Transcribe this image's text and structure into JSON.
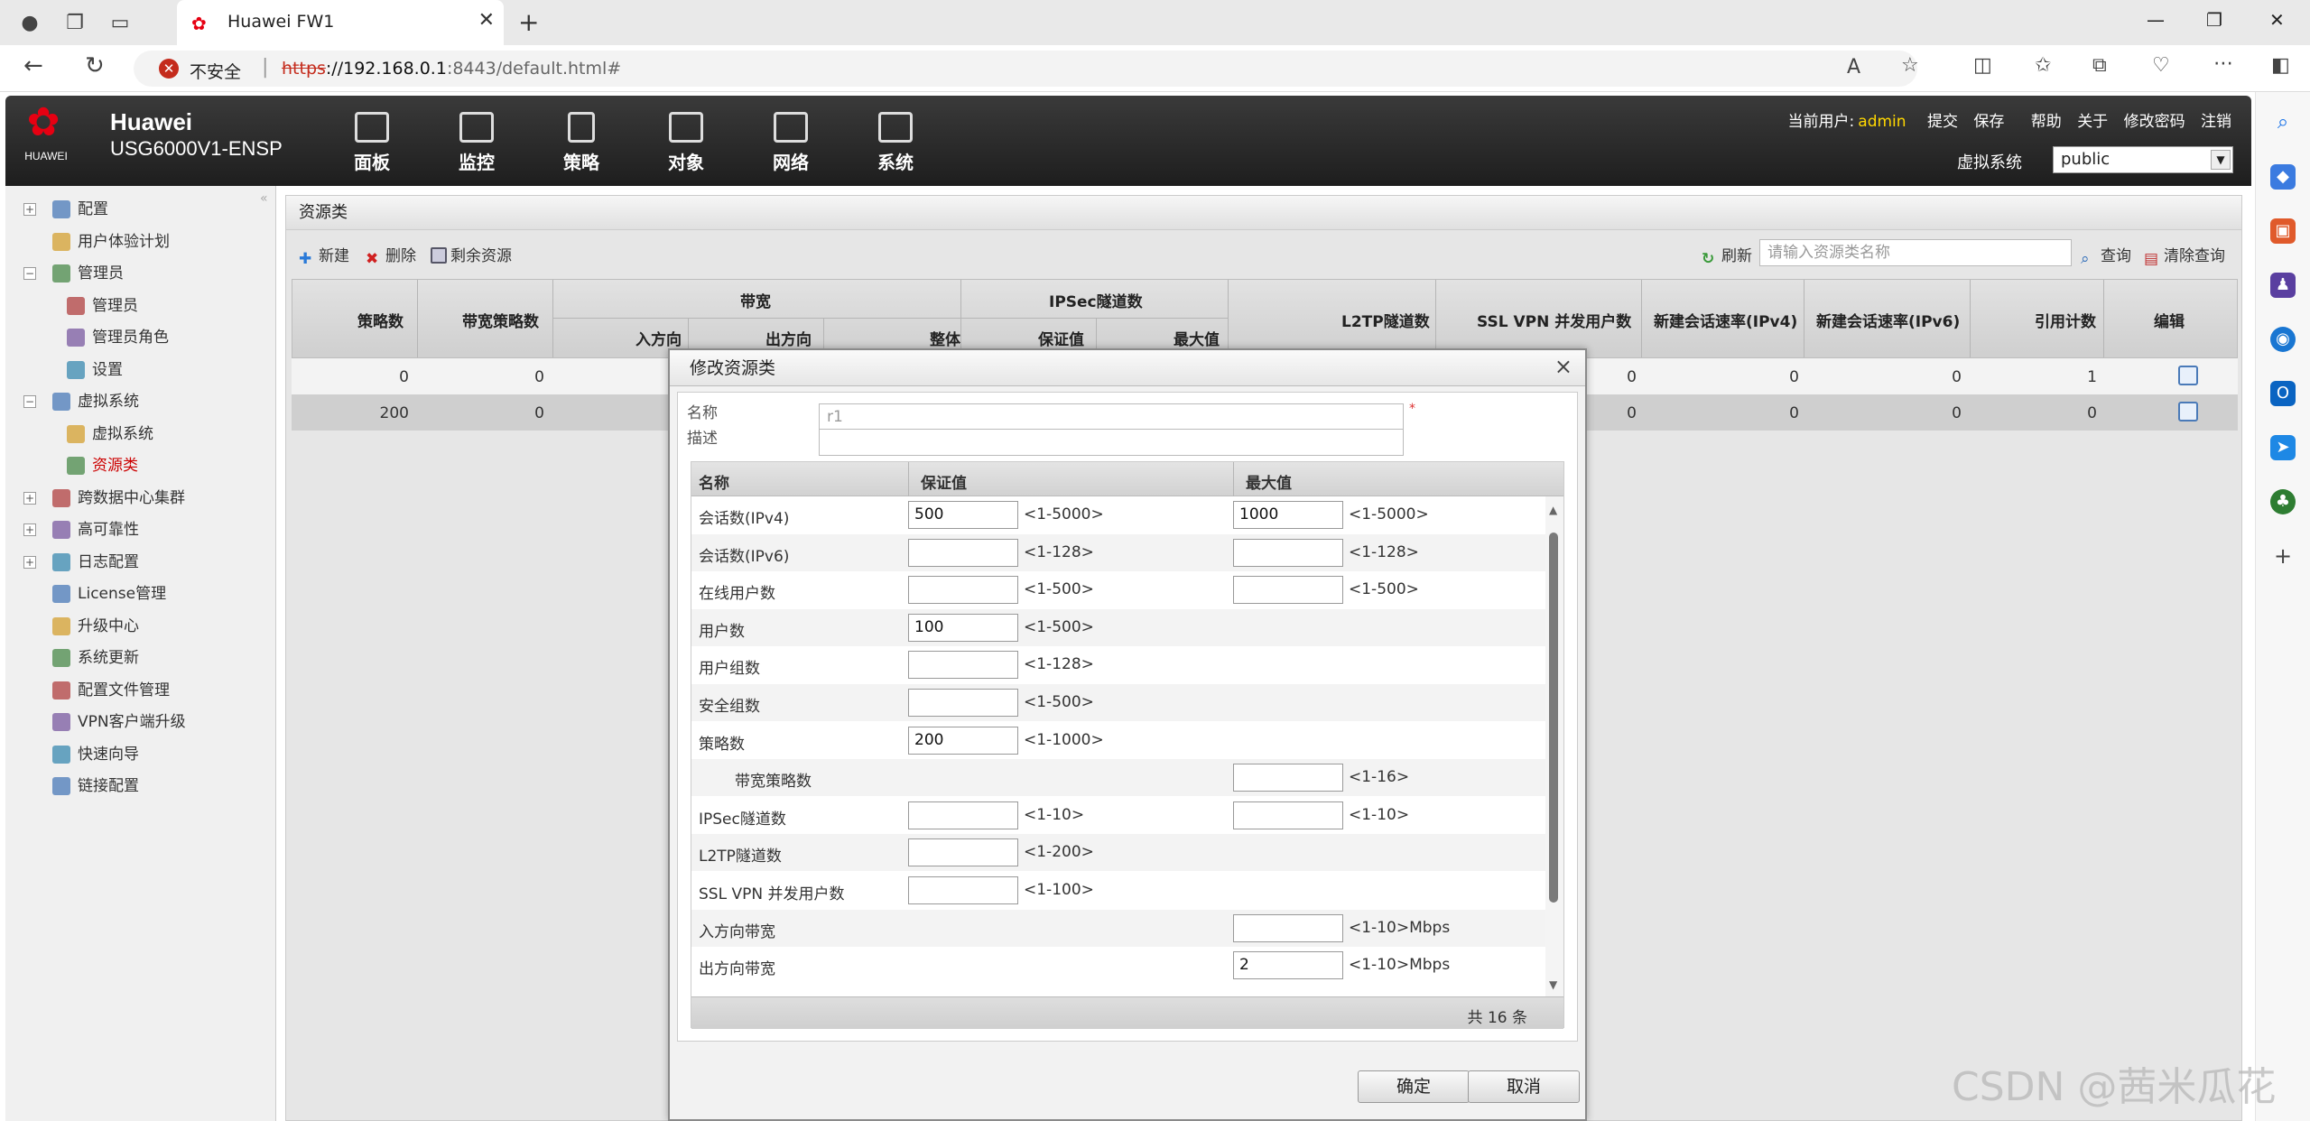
{
  "browser": {
    "tab_title": "Huawei FW1",
    "security_label": "不安全",
    "url_scheme": "https",
    "url_host": "://192.168.0.1",
    "url_rest": ":8443/default.html#"
  },
  "app": {
    "brand": "HUAWEI",
    "product_name": "Huawei",
    "product_model": "USG6000V1-ENSP",
    "nav": [
      "面板",
      "监控",
      "策略",
      "对象",
      "网络",
      "系统"
    ],
    "current_user_label": "当前用户:",
    "current_user": "admin",
    "links": [
      "提交",
      "保存",
      "帮助",
      "关于",
      "修改密码",
      "注销"
    ],
    "vsys_label": "虚拟系统",
    "vsys_value": "public"
  },
  "leftnav": [
    {
      "label": "配置",
      "type": "group"
    },
    {
      "label": "用户体验计划",
      "type": "item"
    },
    {
      "label": "管理员",
      "type": "group"
    },
    {
      "label": "管理员",
      "type": "sub"
    },
    {
      "label": "管理员角色",
      "type": "sub"
    },
    {
      "label": "设置",
      "type": "sub"
    },
    {
      "label": "虚拟系统",
      "type": "group"
    },
    {
      "label": "虚拟系统",
      "type": "sub"
    },
    {
      "label": "资源类",
      "type": "sub",
      "selected": true
    },
    {
      "label": "跨数据中心集群",
      "type": "group"
    },
    {
      "label": "高可靠性",
      "type": "group"
    },
    {
      "label": "日志配置",
      "type": "group"
    },
    {
      "label": "License管理",
      "type": "item"
    },
    {
      "label": "升级中心",
      "type": "item"
    },
    {
      "label": "系统更新",
      "type": "item"
    },
    {
      "label": "配置文件管理",
      "type": "item"
    },
    {
      "label": "VPN客户端升级",
      "type": "item"
    },
    {
      "label": "快速向导",
      "type": "item"
    },
    {
      "label": "链接配置",
      "type": "item"
    }
  ],
  "main": {
    "title": "资源类",
    "toolbar": {
      "new": "新建",
      "delete": "删除",
      "remaining": "剩余资源",
      "refresh": "刷新",
      "search_placeholder": "请输入资源类名称",
      "query": "查询",
      "clear": "清除查询"
    },
    "columns": {
      "policy_count": "策略数",
      "bw_policy_count": "带宽策略数",
      "bandwidth": "带宽",
      "inbound": "入方向",
      "outbound": "出方向",
      "overall": "整体",
      "ipsec": "IPSec隧道数",
      "guaranteed": "保证值",
      "max": "最大值",
      "l2tp": "L2TP隧道数",
      "sslvpn": "SSL VPN 并发用户数",
      "new_session_v4": "新建会话速率(IPv4)",
      "new_session_v6": "新建会话速率(IPv6)",
      "ref_count": "引用计数",
      "edit": "编辑"
    },
    "rows": [
      {
        "policy": "0",
        "bw_policy": "0",
        "sslvpn": "0",
        "v4": "0",
        "v6": "0",
        "ref": "1"
      },
      {
        "policy": "200",
        "bw_policy": "0",
        "sslvpn": "0",
        "v4": "0",
        "v6": "0",
        "ref": "0"
      }
    ]
  },
  "modal": {
    "title": "修改资源类",
    "name_label": "名称",
    "name_value": "r1",
    "required_mark": "*",
    "desc_label": "描述",
    "desc_value": "",
    "columns": {
      "name": "名称",
      "guaranteed": "保证值",
      "max": "最大值"
    },
    "rows": [
      {
        "name": "会话数(IPv4)",
        "g": "500",
        "g_range": "<1-5000>",
        "m": "1000",
        "m_range": "<1-5000>"
      },
      {
        "name": "会话数(IPv6)",
        "g": "",
        "g_range": "<1-128>",
        "m": "",
        "m_range": "<1-128>"
      },
      {
        "name": "在线用户数",
        "g": "",
        "g_range": "<1-500>",
        "m": "",
        "m_range": "<1-500>"
      },
      {
        "name": "用户数",
        "g": "100",
        "g_range": "<1-500>"
      },
      {
        "name": "用户组数",
        "g": "",
        "g_range": "<1-128>"
      },
      {
        "name": "安全组数",
        "g": "",
        "g_range": "<1-500>"
      },
      {
        "name": "策略数",
        "g": "200",
        "g_range": "<1-1000>"
      },
      {
        "name": "带宽策略数",
        "indent": true,
        "m": "",
        "m_range": "<1-16>"
      },
      {
        "name": "IPSec隧道数",
        "g": "",
        "g_range": "<1-10>",
        "m": "",
        "m_range": "<1-10>"
      },
      {
        "name": "L2TP隧道数",
        "g": "",
        "g_range": "<1-200>"
      },
      {
        "name": "SSL VPN 并发用户数",
        "g": "",
        "g_range": "<1-100>"
      },
      {
        "name": "入方向带宽",
        "m": "",
        "m_range": "<1-10>Mbps"
      },
      {
        "name": "出方向带宽",
        "m": "2",
        "m_range": "<1-10>Mbps"
      }
    ],
    "total": "共 16 条",
    "ok": "确定",
    "cancel": "取消"
  },
  "watermark": "CSDN @茜米瓜花"
}
